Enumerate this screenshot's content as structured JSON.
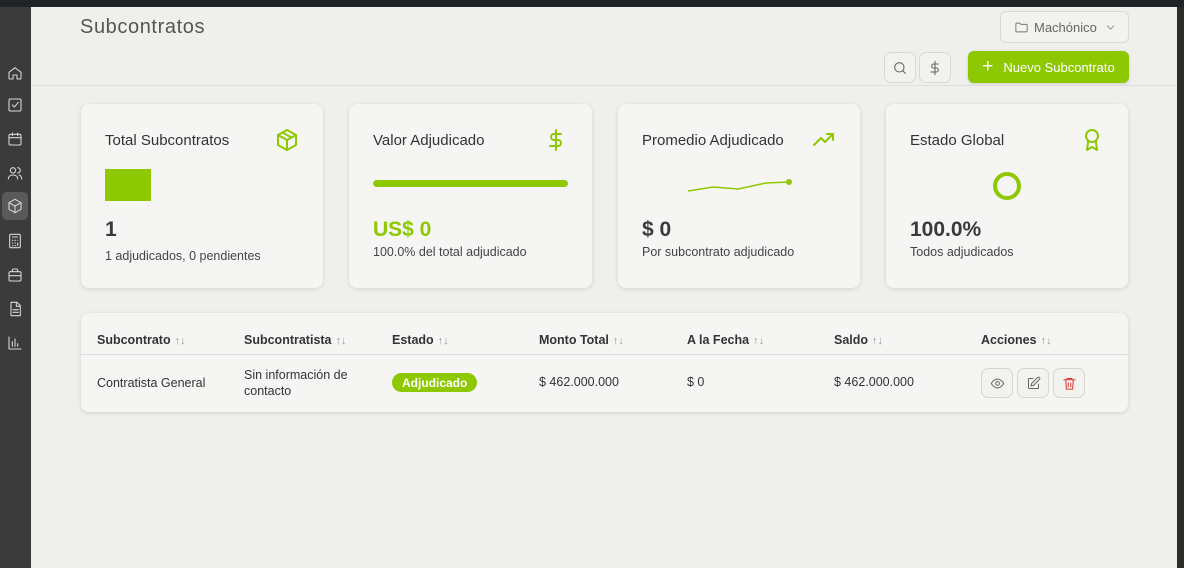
{
  "header": {
    "title": "Subcontratos",
    "project_selector": "Machónico",
    "new_button_label": "Nuevo Subcontrato"
  },
  "sidebar": {
    "items": [
      {
        "icon": "home-icon"
      },
      {
        "icon": "checklist-icon"
      },
      {
        "icon": "calendar-icon"
      },
      {
        "icon": "users-icon"
      },
      {
        "icon": "package-icon",
        "active": true
      },
      {
        "icon": "calculator-icon"
      },
      {
        "icon": "briefcase-icon"
      },
      {
        "icon": "document-icon"
      },
      {
        "icon": "bar-chart-icon"
      }
    ]
  },
  "stats": {
    "total": {
      "title": "Total Subcontratos",
      "value": "1",
      "sub": "1 adjudicados, 0 pendientes"
    },
    "valor": {
      "title": "Valor Adjudicado",
      "value": "US$ 0",
      "sub": "100.0% del total adjudicado",
      "progress_fraction": 1.0
    },
    "promedio": {
      "title": "Promedio Adjudicado",
      "value": "$ 0",
      "sub": "Por subcontrato adjudicado"
    },
    "estado": {
      "title": "Estado Global",
      "value": "100.0%",
      "sub": "Todos adjudicados"
    }
  },
  "table": {
    "columns": [
      "Subcontrato",
      "Subcontratista",
      "Estado",
      "Monto Total",
      "A la Fecha",
      "Saldo",
      "Acciones"
    ],
    "sort_glyph": "↑↓",
    "rows": [
      {
        "subcontrato": "Contratista General",
        "subcontratista_line1": "Sin información de",
        "subcontratista_line2": "contacto",
        "estado": "Adjudicado",
        "monto_total": "$ 462.000.000",
        "a_la_fecha": "$ 0",
        "saldo": "$ 462.000.000"
      }
    ]
  },
  "colors": {
    "accent": "#8dc800",
    "danger": "#d9342b",
    "background": "#efefec",
    "sidebar": "#3b3b3b"
  }
}
